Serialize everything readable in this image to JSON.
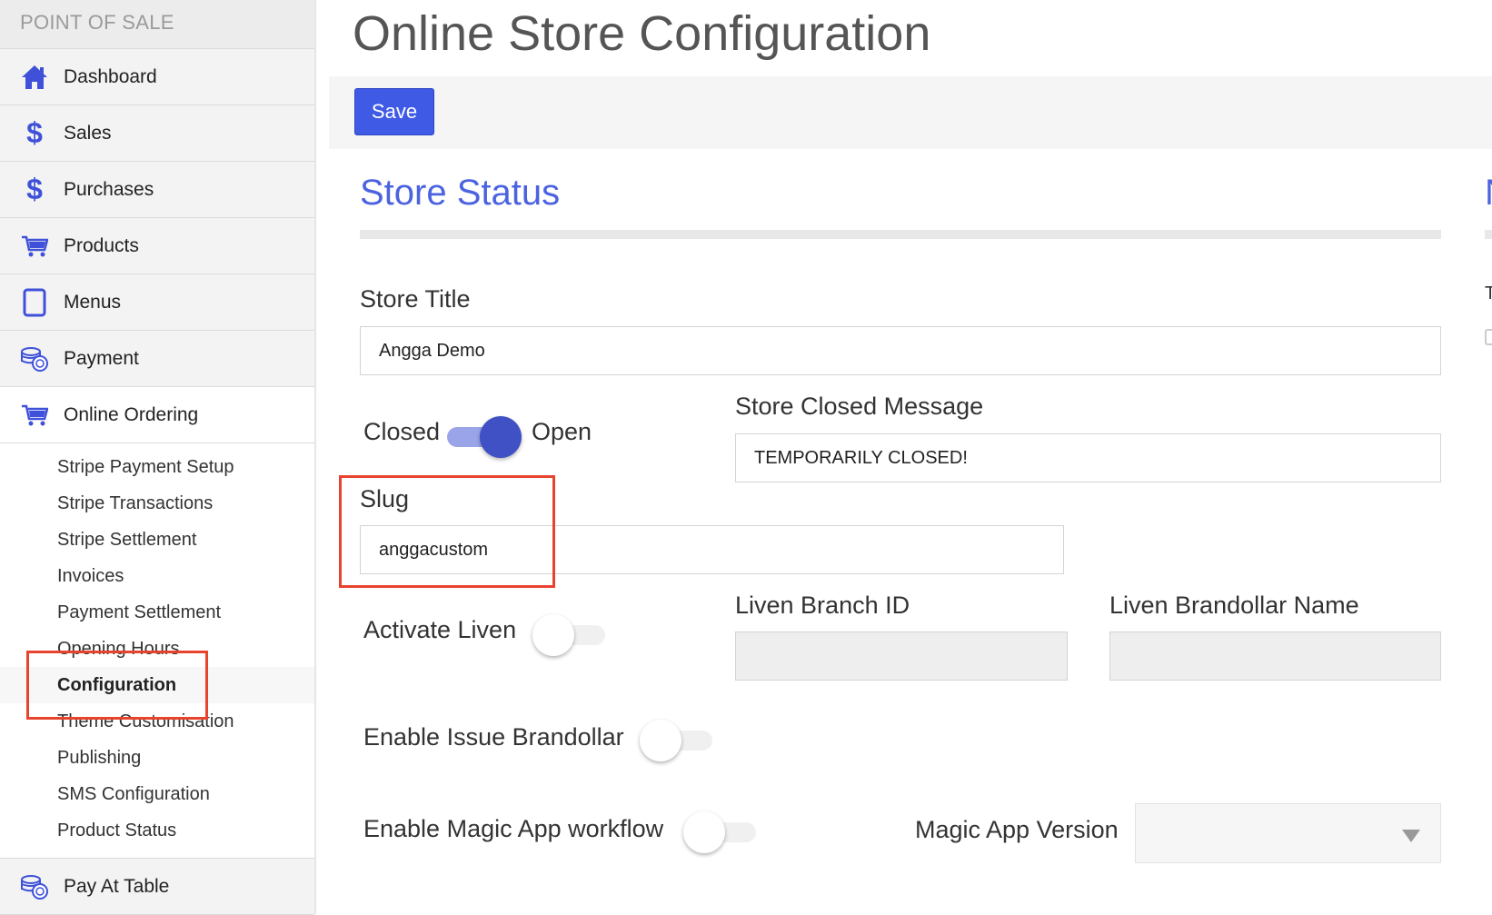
{
  "sidebar": {
    "header": "POINT OF SALE",
    "items": [
      {
        "label": "Dashboard",
        "icon": "home-icon"
      },
      {
        "label": "Sales",
        "icon": "dollar-icon"
      },
      {
        "label": "Purchases",
        "icon": "dollar-icon"
      },
      {
        "label": "Products",
        "icon": "cart-icon"
      },
      {
        "label": "Menus",
        "icon": "tablet-icon"
      },
      {
        "label": "Payment",
        "icon": "coins-icon"
      },
      {
        "label": "Online Ordering",
        "icon": "cart-icon"
      }
    ],
    "online_ordering_subitems": [
      "Stripe Payment Setup",
      "Stripe Transactions",
      "Stripe Settlement",
      "Invoices",
      "Payment Settlement",
      "Opening Hours",
      "Configuration",
      "Theme Customisation",
      "Publishing",
      "SMS Configuration",
      "Product Status"
    ],
    "active_subitem": "Configuration",
    "bottom_item": {
      "label": "Pay At Table",
      "icon": "coins-icon"
    }
  },
  "main": {
    "title": "Online Store Configuration",
    "save_label": "Save",
    "section_title": "Store Status",
    "store_title_label": "Store Title",
    "store_title_value": "Angga Demo",
    "closed_label": "Closed",
    "open_label": "Open",
    "store_open": true,
    "store_closed_message_label": "Store Closed Message",
    "store_closed_message_value": "TEMPORARILY CLOSED!",
    "slug_label": "Slug",
    "slug_value": "anggacustom",
    "activate_liven_label": "Activate Liven",
    "activate_liven": false,
    "liven_branch_id_label": "Liven Branch ID",
    "liven_branch_id_value": "",
    "liven_brandollar_name_label": "Liven Brandollar Name",
    "liven_brandollar_name_value": "",
    "enable_issue_brandollar_label": "Enable Issue Brandollar",
    "enable_issue_brandollar": false,
    "enable_magic_app_label": "Enable Magic App workflow",
    "enable_magic_app": false,
    "magic_app_version_label": "Magic App Version",
    "magic_app_version_value": ""
  },
  "colors": {
    "accent": "#3f5be6",
    "section_title": "#4b63e0",
    "highlight_box": "#e8432e"
  }
}
